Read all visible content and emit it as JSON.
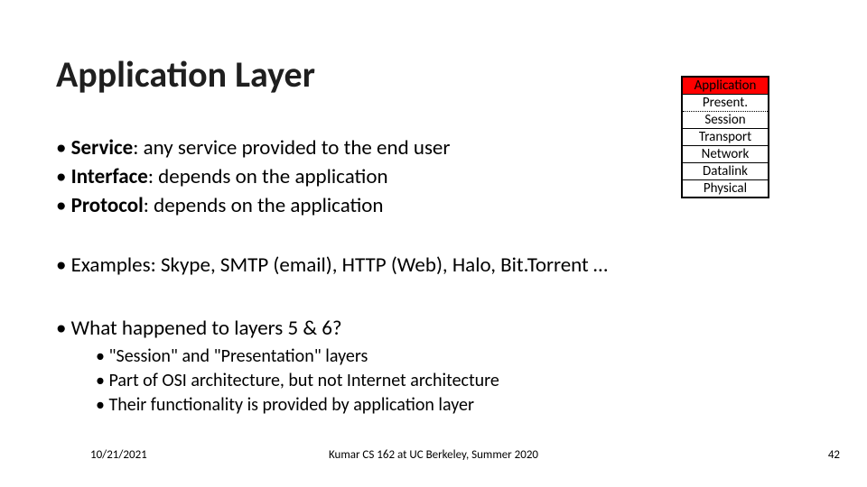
{
  "title": "Application Layer",
  "osi": [
    "Application",
    "Present.",
    "Session",
    "Transport",
    "Network",
    "Datalink",
    "Physical"
  ],
  "bullets": [
    {
      "bold": "Service",
      "rest": ": any service provided to the end user"
    },
    {
      "bold": "Interface",
      "rest": ": depends on the application"
    },
    {
      "bold": "Protocol",
      "rest": ": depends on the application"
    }
  ],
  "examples": "Examples: Skype, SMTP (email), HTTP (Web), Halo, Bit.Torrent  …",
  "question": "What happened to layers 5 & 6?",
  "sub": [
    "\"Session\" and \"Presentation\" layers",
    "Part of OSI architecture, but not Internet architecture",
    "Their functionality is provided by application layer"
  ],
  "footer": {
    "date": "10/21/2021",
    "center": "Kumar CS 162 at UC Berkeley, Summer 2020",
    "page": "42"
  }
}
